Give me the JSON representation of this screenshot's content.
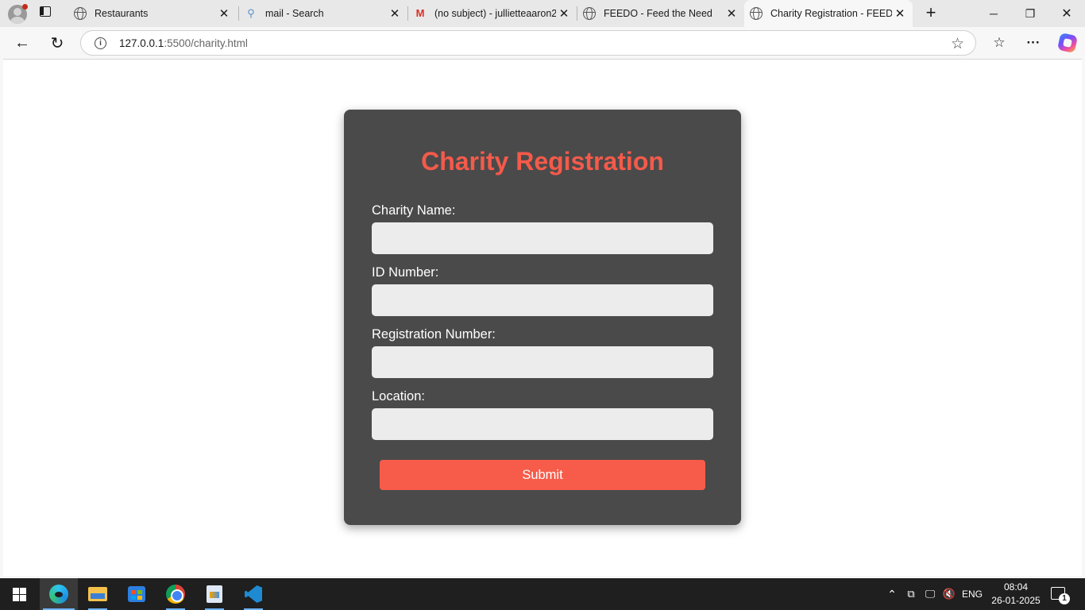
{
  "browser": {
    "tabs": [
      {
        "label": "Restaurants",
        "icon": "globe-icon"
      },
      {
        "label": "mail - Search",
        "icon": "search-icon"
      },
      {
        "label": "(no subject) - jullietteaaron2",
        "icon": "gmail-icon"
      },
      {
        "label": "FEEDO - Feed the Need",
        "icon": "globe-icon"
      },
      {
        "label": "Charity Registration - FEEDO",
        "icon": "globe-icon",
        "active": true
      }
    ],
    "address": {
      "host": "127.0.0.1",
      "path": ":5500/charity.html"
    }
  },
  "form": {
    "title": "Charity Registration",
    "fields": [
      {
        "label": "Charity Name:",
        "value": ""
      },
      {
        "label": "ID Number:",
        "value": ""
      },
      {
        "label": "Registration Number:",
        "value": ""
      },
      {
        "label": "Location:",
        "value": ""
      }
    ],
    "submit_label": "Submit",
    "colors": {
      "accent": "#f55a4a",
      "card": "#4a4a4a",
      "input": "#ececec"
    }
  },
  "taskbar": {
    "apps": [
      "edge-icon",
      "file-explorer-icon",
      "store-icon",
      "chrome-icon",
      "paint-icon",
      "vscode-icon"
    ],
    "language": "ENG",
    "time": "08:04",
    "date": "26-01-2025",
    "notifications": "1"
  }
}
